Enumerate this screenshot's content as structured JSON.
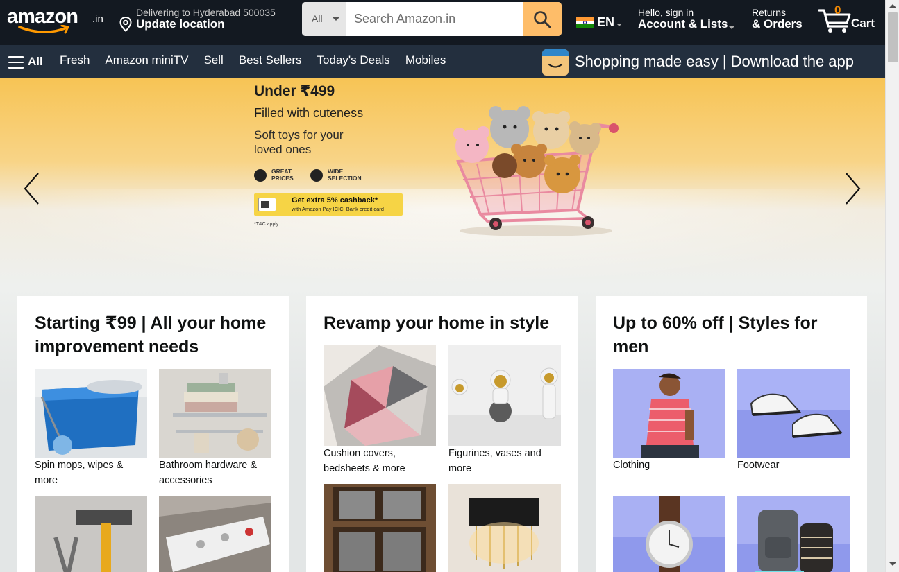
{
  "header": {
    "logo_text": "amazon",
    "logo_tld": ".in",
    "deliver": {
      "line1": "Delivering to Hyderabad 500035",
      "line2": "Update location"
    },
    "search": {
      "category": "All",
      "placeholder": "Search Amazon.in"
    },
    "language": "EN",
    "account": {
      "line1": "Hello, sign in",
      "line2": "Account & Lists"
    },
    "returns": {
      "line1": "Returns",
      "line2": "& Orders"
    },
    "cart": {
      "count": "0",
      "label": "Cart"
    }
  },
  "nav": {
    "all_label": "All",
    "links": [
      "Fresh",
      "Amazon miniTV",
      "Sell",
      "Best Sellers",
      "Today's Deals",
      "Mobiles"
    ],
    "promo": "Shopping made easy | Download the app"
  },
  "hero": {
    "headline": "Under ₹499",
    "subhead": "Filled with cuteness",
    "line1": "Soft toys for your",
    "line2": "loved ones",
    "badge1": "GREAT PRICES",
    "badge2": "WIDE SELECTION",
    "cashback_l1": "Get extra 5% cashback*",
    "cashback_l2": "with Amazon Pay ICICI Bank credit card",
    "tnc": "*T&C apply"
  },
  "cards": [
    {
      "title": "Starting ₹99 | All your home improvement needs",
      "tiles": [
        "Spin mops, wipes & more",
        "Bathroom hardware & accessories",
        "",
        ""
      ]
    },
    {
      "title": "Revamp your home in style",
      "tiles": [
        "Cushion covers, bedsheets & more",
        "Figurines, vases and more",
        "",
        ""
      ]
    },
    {
      "title": "Up to 60% off | Styles for men",
      "tiles": [
        "Clothing",
        "Footwear",
        "",
        ""
      ]
    }
  ],
  "colors": {
    "nav_dark": "#131921",
    "nav_secondary": "#232f3e",
    "search_button": "#febd69",
    "cart_count": "#f08804",
    "hero_yellow": "#f7c455"
  }
}
